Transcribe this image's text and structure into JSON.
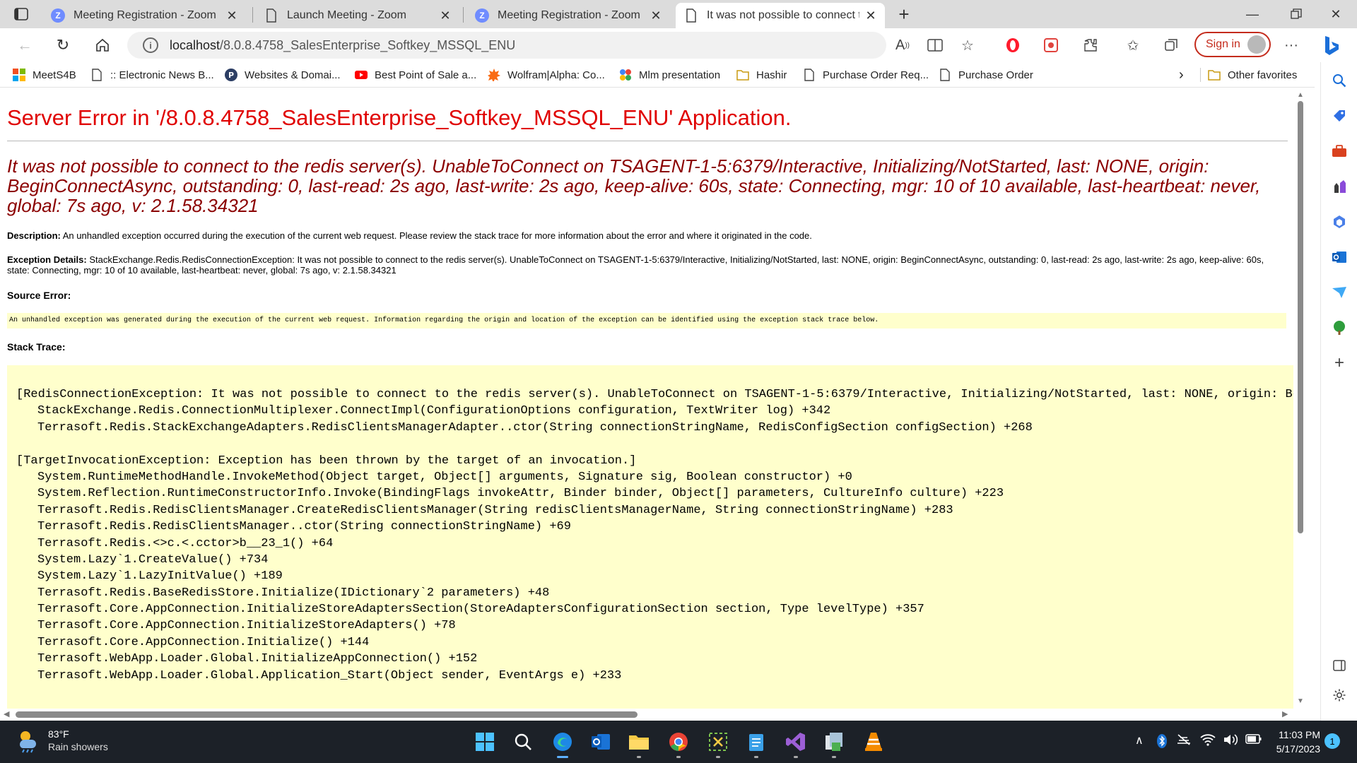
{
  "browser": {
    "tabs": [
      {
        "label": "Meeting Registration - Zoom",
        "icon": "zoom-icon",
        "active": false
      },
      {
        "label": "Launch Meeting - Zoom",
        "icon": "document-icon",
        "active": false
      },
      {
        "label": "Meeting Registration - Zoom",
        "icon": "zoom-icon",
        "active": false
      },
      {
        "label": "It was not possible to connect to",
        "icon": "document-icon",
        "active": true
      }
    ],
    "new_tab_label": "+",
    "url_host": "localhost",
    "url_path": "/8.0.8.4758_SalesEnterprise_Softkey_MSSQL_ENU",
    "sign_in_label": "Sign in",
    "favorites": [
      {
        "label": "MeetS4B",
        "icon": "windows-logo-icon"
      },
      {
        "label": ":: Electronic News B...",
        "icon": "document-icon"
      },
      {
        "label": "Websites & Domai...",
        "icon": "p-logo-icon"
      },
      {
        "label": "Best Point of Sale a...",
        "icon": "youtube-icon"
      },
      {
        "label": "Wolfram|Alpha: Co...",
        "icon": "wolfram-icon"
      },
      {
        "label": "Mlm presentation",
        "icon": "colorful-icon"
      },
      {
        "label": "Hashir",
        "icon": "folder-icon"
      },
      {
        "label": "Purchase Order Req...",
        "icon": "document-icon"
      },
      {
        "label": "Purchase Order",
        "icon": "document-icon"
      }
    ],
    "other_favorites_label": "Other favorites"
  },
  "page": {
    "title": "Server Error in '/8.0.8.4758_SalesEnterprise_Softkey_MSSQL_ENU' Application.",
    "error_message": "It was not possible to connect to the redis server(s). UnableToConnect on TSAGENT-1-5:6379/Interactive, Initializing/NotStarted, last: NONE, origin: BeginConnectAsync, outstanding: 0, last-read: 2s ago, last-write: 2s ago, keep-alive: 60s, state: Connecting, mgr: 10 of 10 available, last-heartbeat: never, global: 7s ago, v: 2.1.58.34321",
    "description_label": "Description:",
    "description_text": "An unhandled exception occurred during the execution of the current web request. Please review the stack trace for more information about the error and where it originated in the code.",
    "exception_label": "Exception Details:",
    "exception_text": "StackExchange.Redis.RedisConnectionException: It was not possible to connect to the redis server(s). UnableToConnect on TSAGENT-1-5:6379/Interactive, Initializing/NotStarted, last: NONE, origin: BeginConnectAsync, outstanding: 0, last-read: 2s ago, last-write: 2s ago, keep-alive: 60s, state: Connecting, mgr: 10 of 10 available, last-heartbeat: never, global: 7s ago, v: 2.1.58.34321",
    "source_error_label": "Source Error:",
    "source_error_text": "An unhandled exception was generated during the execution of the current web request. Information regarding the origin and location of the exception can be identified using the exception stack trace below.",
    "stack_trace_label": "Stack Trace:",
    "stack_trace": [
      {
        "text": "[RedisConnectionException: It was not possible to connect to the redis server(s). UnableToConnect on TSAGENT-1-5:6379/Interactive, Initializing/NotStarted, last: NONE, origin: Begi",
        "indent": false
      },
      {
        "text": "StackExchange.Redis.ConnectionMultiplexer.ConnectImpl(ConfigurationOptions configuration, TextWriter log) +342",
        "indent": true
      },
      {
        "text": "Terrasoft.Redis.StackExchangeAdapters.RedisClientsManagerAdapter..ctor(String connectionStringName, RedisConfigSection configSection) +268",
        "indent": true
      },
      {
        "text": "",
        "indent": false
      },
      {
        "text": "[TargetInvocationException: Exception has been thrown by the target of an invocation.]",
        "indent": false
      },
      {
        "text": "System.RuntimeMethodHandle.InvokeMethod(Object target, Object[] arguments, Signature sig, Boolean constructor) +0",
        "indent": true
      },
      {
        "text": "System.Reflection.RuntimeConstructorInfo.Invoke(BindingFlags invokeAttr, Binder binder, Object[] parameters, CultureInfo culture) +223",
        "indent": true
      },
      {
        "text": "Terrasoft.Redis.RedisClientsManager.CreateRedisClientsManager(String redisClientsManagerName, String connectionStringName) +283",
        "indent": true
      },
      {
        "text": "Terrasoft.Redis.RedisClientsManager..ctor(String connectionStringName) +69",
        "indent": true
      },
      {
        "text": "Terrasoft.Redis.<>c.<.cctor>b__23_1() +64",
        "indent": true
      },
      {
        "text": "System.Lazy`1.CreateValue() +734",
        "indent": true
      },
      {
        "text": "System.Lazy`1.LazyInitValue() +189",
        "indent": true
      },
      {
        "text": "Terrasoft.Redis.BaseRedisStore.Initialize(IDictionary`2 parameters) +48",
        "indent": true
      },
      {
        "text": "Terrasoft.Core.AppConnection.InitializeStoreAdaptersSection(StoreAdaptersConfigurationSection section, Type levelType) +357",
        "indent": true
      },
      {
        "text": "Terrasoft.Core.AppConnection.InitializeStoreAdapters() +78",
        "indent": true
      },
      {
        "text": "Terrasoft.Core.AppConnection.Initialize() +144",
        "indent": true
      },
      {
        "text": "Terrasoft.WebApp.Loader.Global.InitializeAppConnection() +152",
        "indent": true
      },
      {
        "text": "Terrasoft.WebApp.Loader.Global.Application_Start(Object sender, EventArgs e) +233",
        "indent": true
      }
    ]
  },
  "taskbar": {
    "weather_temp": "83°F",
    "weather_desc": "Rain showers",
    "time": "11:03 PM",
    "date": "5/17/2023",
    "notification_count": "1"
  },
  "colors": {
    "title_red": "#e00000",
    "message_darkred": "#8b0000",
    "code_bg": "#ffffcc",
    "signin_red": "#c42b1c",
    "taskbar_bg": "#1c2128"
  }
}
